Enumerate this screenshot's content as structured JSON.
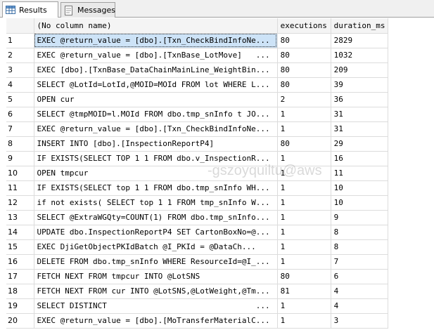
{
  "tabs": [
    {
      "label": "Results",
      "icon": "grid-icon",
      "active": true
    },
    {
      "label": "Messages",
      "icon": "messages-icon",
      "active": false
    }
  ],
  "columns": [
    "(No column name)",
    "executions",
    "duration_ms"
  ],
  "rows": [
    {
      "num": "1",
      "query": "EXEC @return_value = [dbo].[Txn_CheckBindInfoNe...",
      "executions": "80",
      "duration": "2829"
    },
    {
      "num": "2",
      "query": "EXEC @return_value = [dbo].[TxnBase_LotMove]",
      "executions": "80",
      "duration": "1032"
    },
    {
      "num": "3",
      "query": "EXEC [dbo].[TxnBase_DataChainMainLine_WeightBin...",
      "executions": "80",
      "duration": "209"
    },
    {
      "num": "4",
      "query": "SELECT @LotId=LotId,@MOID=MOId FROM lot WHERE L...",
      "executions": "80",
      "duration": "39"
    },
    {
      "num": "5",
      "query": "OPEN cur",
      "executions": "2",
      "duration": "36"
    },
    {
      "num": "6",
      "query": "SELECT @tmpMOID=l.MOId FROM dbo.tmp_snInfo t JO...",
      "executions": "1",
      "duration": "31"
    },
    {
      "num": "7",
      "query": "EXEC @return_value = [dbo].[Txn_CheckBindInfoNe...",
      "executions": "1",
      "duration": "31"
    },
    {
      "num": "8",
      "query": "INSERT INTO  [dbo].[InspectionReportP4]",
      "executions": "80",
      "duration": "29"
    },
    {
      "num": "9",
      "query": "IF EXISTS(SELECT TOP 1 1 FROM dbo.v_InspectionR...",
      "executions": "1",
      "duration": "16"
    },
    {
      "num": "10",
      "query": "OPEN tmpcur",
      "executions": "1",
      "duration": "11"
    },
    {
      "num": "11",
      "query": "IF EXISTS(SELECT top 1 1 FROM dbo.tmp_snInfo WH...",
      "executions": "1",
      "duration": "10"
    },
    {
      "num": "12",
      "query": "if not exists( SELECT top 1 1 FROM tmp_snInfo W...",
      "executions": "1",
      "duration": "10"
    },
    {
      "num": "13",
      "query": "SELECT @ExtraWGQty=COUNT(1) FROM dbo.tmp_snInfo...",
      "executions": "1",
      "duration": "9"
    },
    {
      "num": "14",
      "query": "UPDATE dbo.InspectionReportP4 SET CartonBoxNo=@...",
      "executions": "1",
      "duration": "8"
    },
    {
      "num": "15",
      "query": "EXEC DjiGetObjectPKIdBatch    @I_PKId = @DataCh...",
      "executions": "1",
      "duration": "8"
    },
    {
      "num": "16",
      "query": "DELETE FROM dbo.tmp_snInfo WHERE ResourceId=@I_...",
      "executions": "1",
      "duration": "7"
    },
    {
      "num": "17",
      "query": "FETCH NEXT FROM tmpcur INTO @LotSNS",
      "executions": "80",
      "duration": "6"
    },
    {
      "num": "18",
      "query": "FETCH NEXT FROM cur INTO @LotSNS,@LotWeight,@Tm...",
      "executions": "81",
      "duration": "4"
    },
    {
      "num": "19",
      "query": "SELECT DISTINCT",
      "executions": "1",
      "duration": "4"
    },
    {
      "num": "20",
      "query": "EXEC @return_value = [dbo].[MoTransferMaterialC...",
      "executions": "1",
      "duration": "3"
    }
  ],
  "row_suffix": [
    "",
    "...",
    "",
    "",
    "",
    "",
    "",
    "",
    "",
    "",
    "",
    "",
    "",
    "",
    "",
    "",
    "",
    "",
    "...",
    ""
  ],
  "watermark": "-gszoyquiltu@aws"
}
